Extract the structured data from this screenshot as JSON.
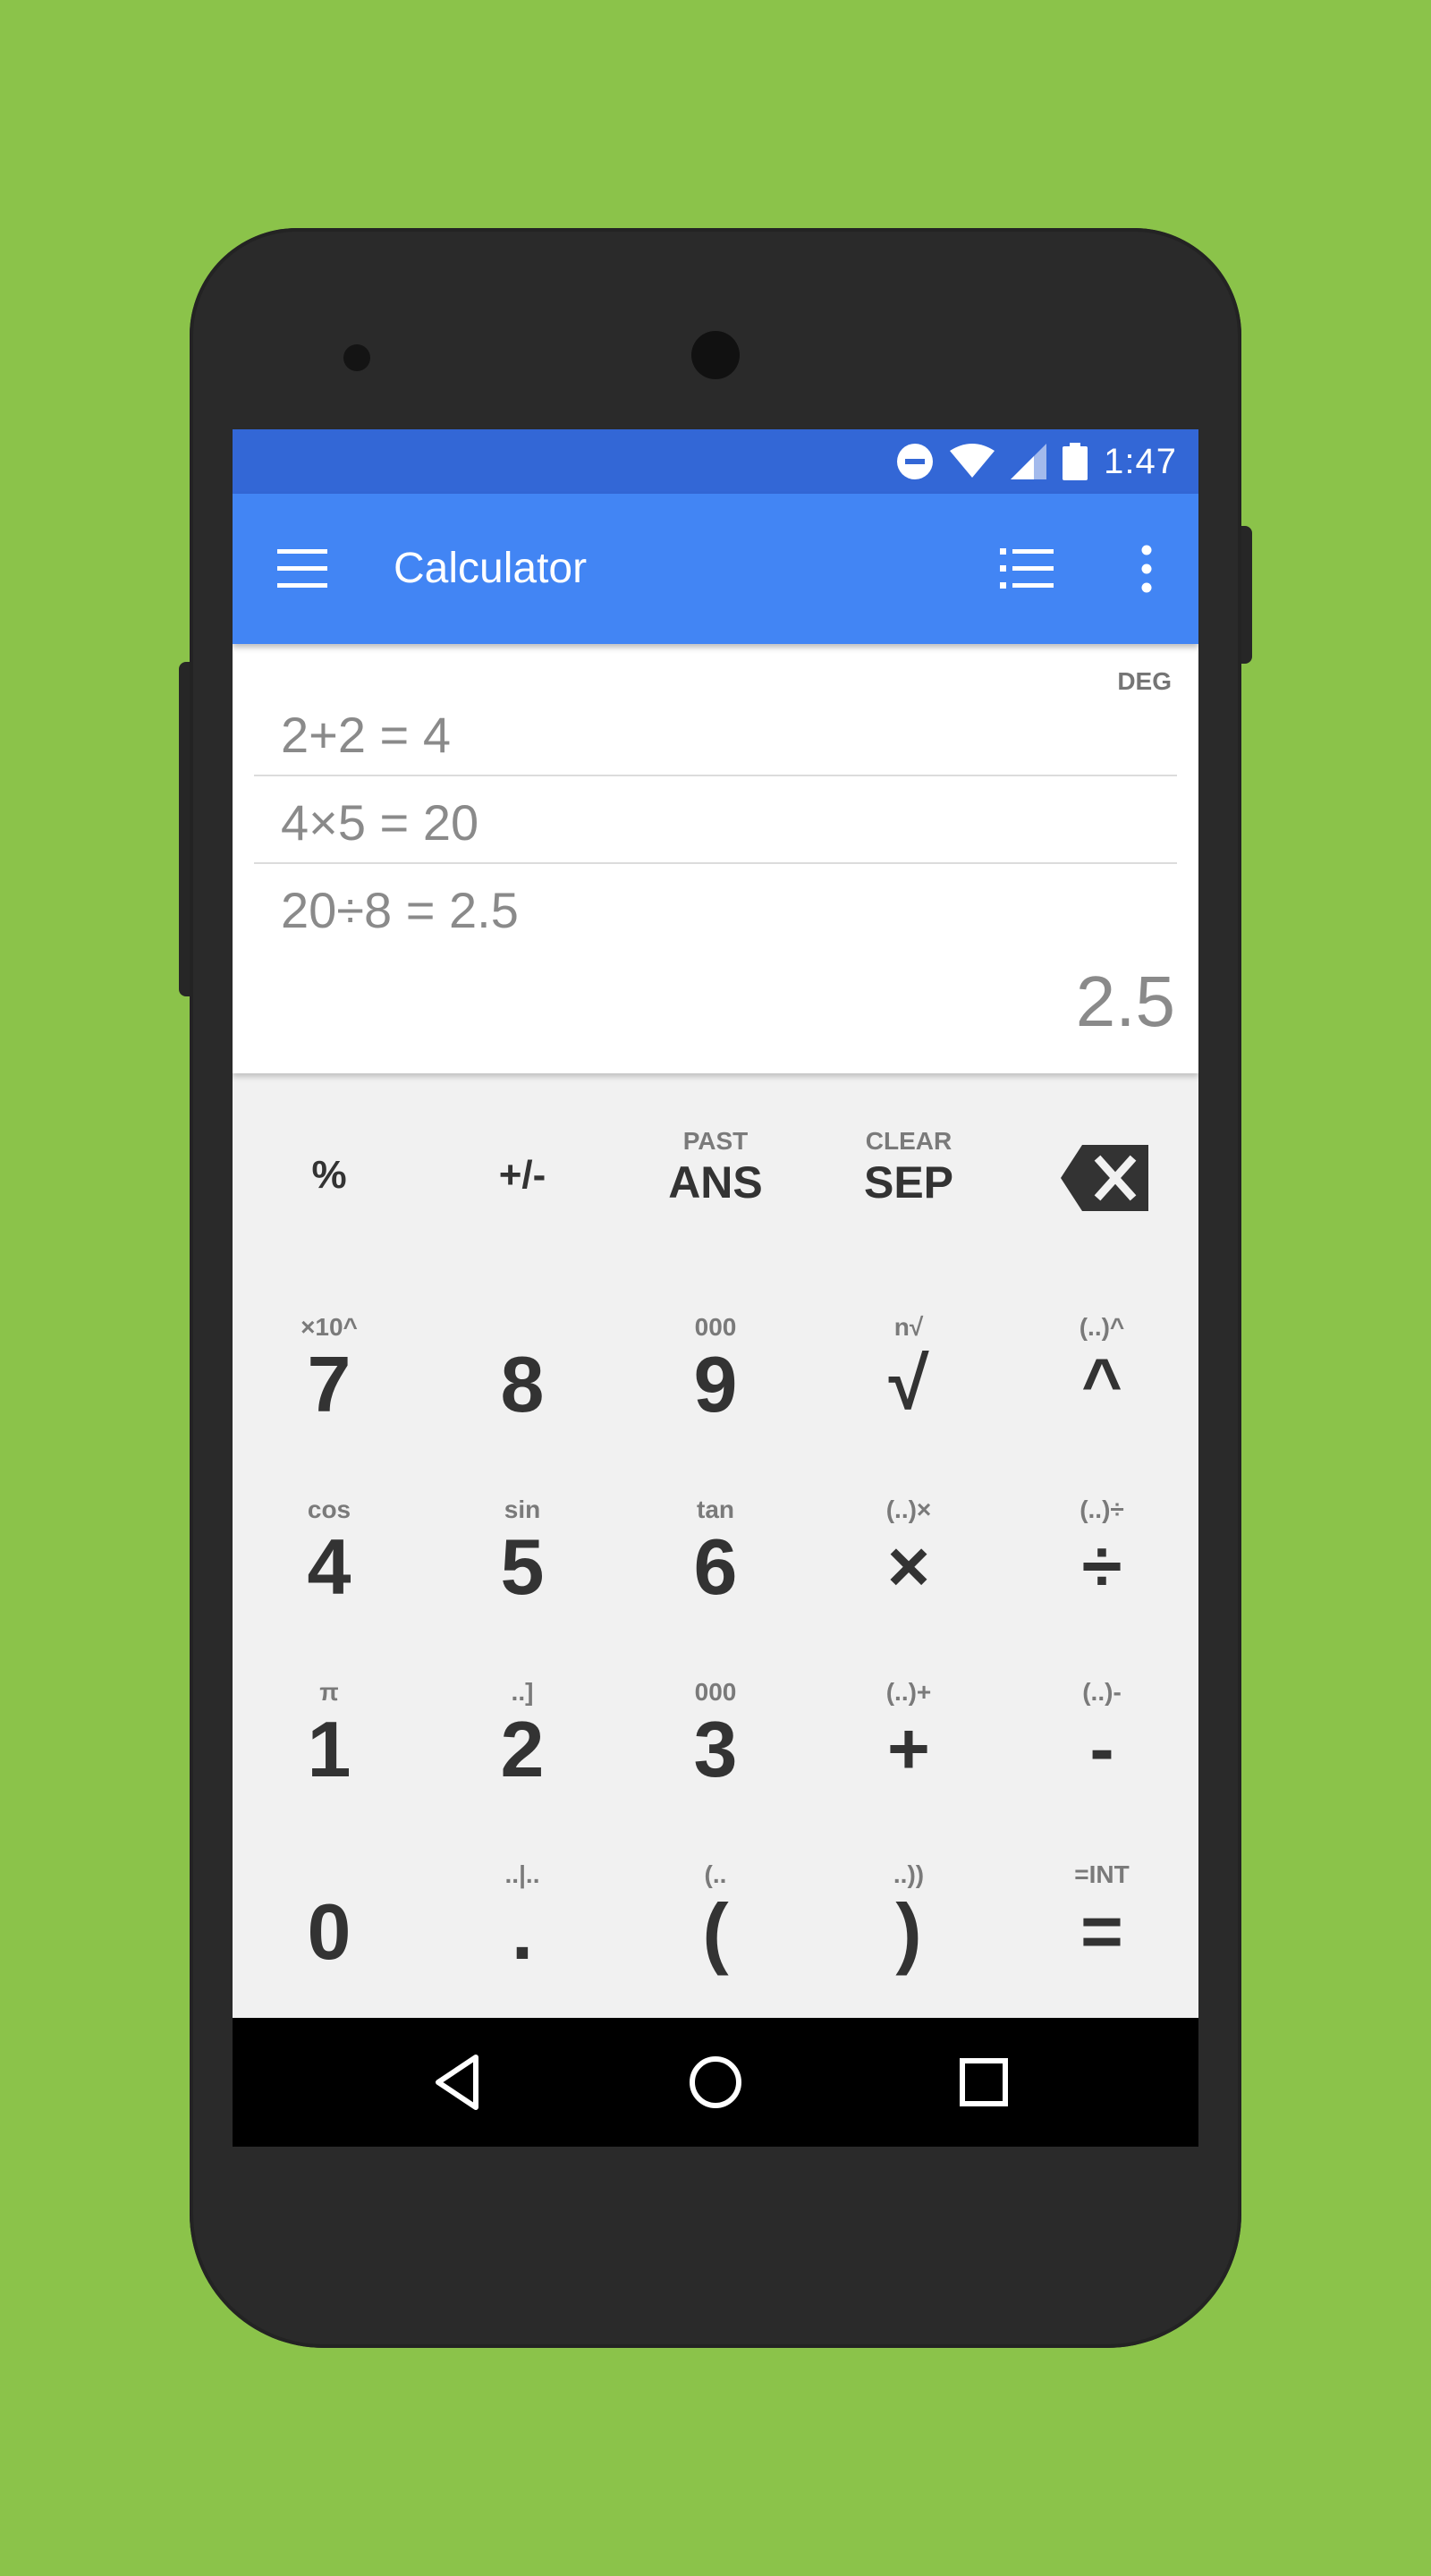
{
  "status_bar": {
    "time": "1:47",
    "icons": [
      "do-not-disturb-icon",
      "wifi-icon",
      "cell-signal-icon",
      "battery-icon"
    ]
  },
  "app_bar": {
    "title": "Calculator",
    "icons": [
      "menu-icon",
      "history-list-icon",
      "more-vert-icon"
    ]
  },
  "display": {
    "mode": "DEG",
    "history": [
      "2+2 = 4",
      "4×5 = 20",
      "20÷8 = 2.5"
    ],
    "result": "2.5"
  },
  "keypad": {
    "top_row": [
      {
        "primary": "%",
        "secondary": ""
      },
      {
        "primary": "+/-",
        "secondary": ""
      },
      {
        "primary": "ANS",
        "secondary": "PAST"
      },
      {
        "primary": "SEP",
        "secondary": "CLEAR"
      },
      {
        "primary": "",
        "secondary": "",
        "icon": "backspace-icon"
      }
    ],
    "rows": [
      [
        {
          "primary": "7",
          "secondary": "×10^"
        },
        {
          "primary": "8",
          "secondary": ""
        },
        {
          "primary": "9",
          "secondary": "000"
        },
        {
          "primary": "√",
          "secondary": "n√"
        },
        {
          "primary": "^",
          "secondary": "(..)^"
        }
      ],
      [
        {
          "primary": "4",
          "secondary": "cos"
        },
        {
          "primary": "5",
          "secondary": "sin"
        },
        {
          "primary": "6",
          "secondary": "tan"
        },
        {
          "primary": "×",
          "secondary": "(..)×"
        },
        {
          "primary": "÷",
          "secondary": "(..)÷"
        }
      ],
      [
        {
          "primary": "1",
          "secondary": "π"
        },
        {
          "primary": "2",
          "secondary": "..]"
        },
        {
          "primary": "3",
          "secondary": "000"
        },
        {
          "primary": "+",
          "secondary": "(..)+"
        },
        {
          "primary": "-",
          "secondary": "(..)-"
        }
      ],
      [
        {
          "primary": "0",
          "secondary": ""
        },
        {
          "primary": ".",
          "secondary": "..|.."
        },
        {
          "primary": "(",
          "secondary": "(.."
        },
        {
          "primary": ")",
          "secondary": "..))"
        },
        {
          "primary": "=",
          "secondary": "=INT"
        }
      ]
    ]
  },
  "nav_bar": {
    "icons": [
      "back-icon",
      "home-icon",
      "recents-icon"
    ]
  },
  "colors": {
    "background": "#8bc34a",
    "status_bar": "#3367d6",
    "app_bar": "#4285f4",
    "keypad": "#f1f1f1"
  }
}
